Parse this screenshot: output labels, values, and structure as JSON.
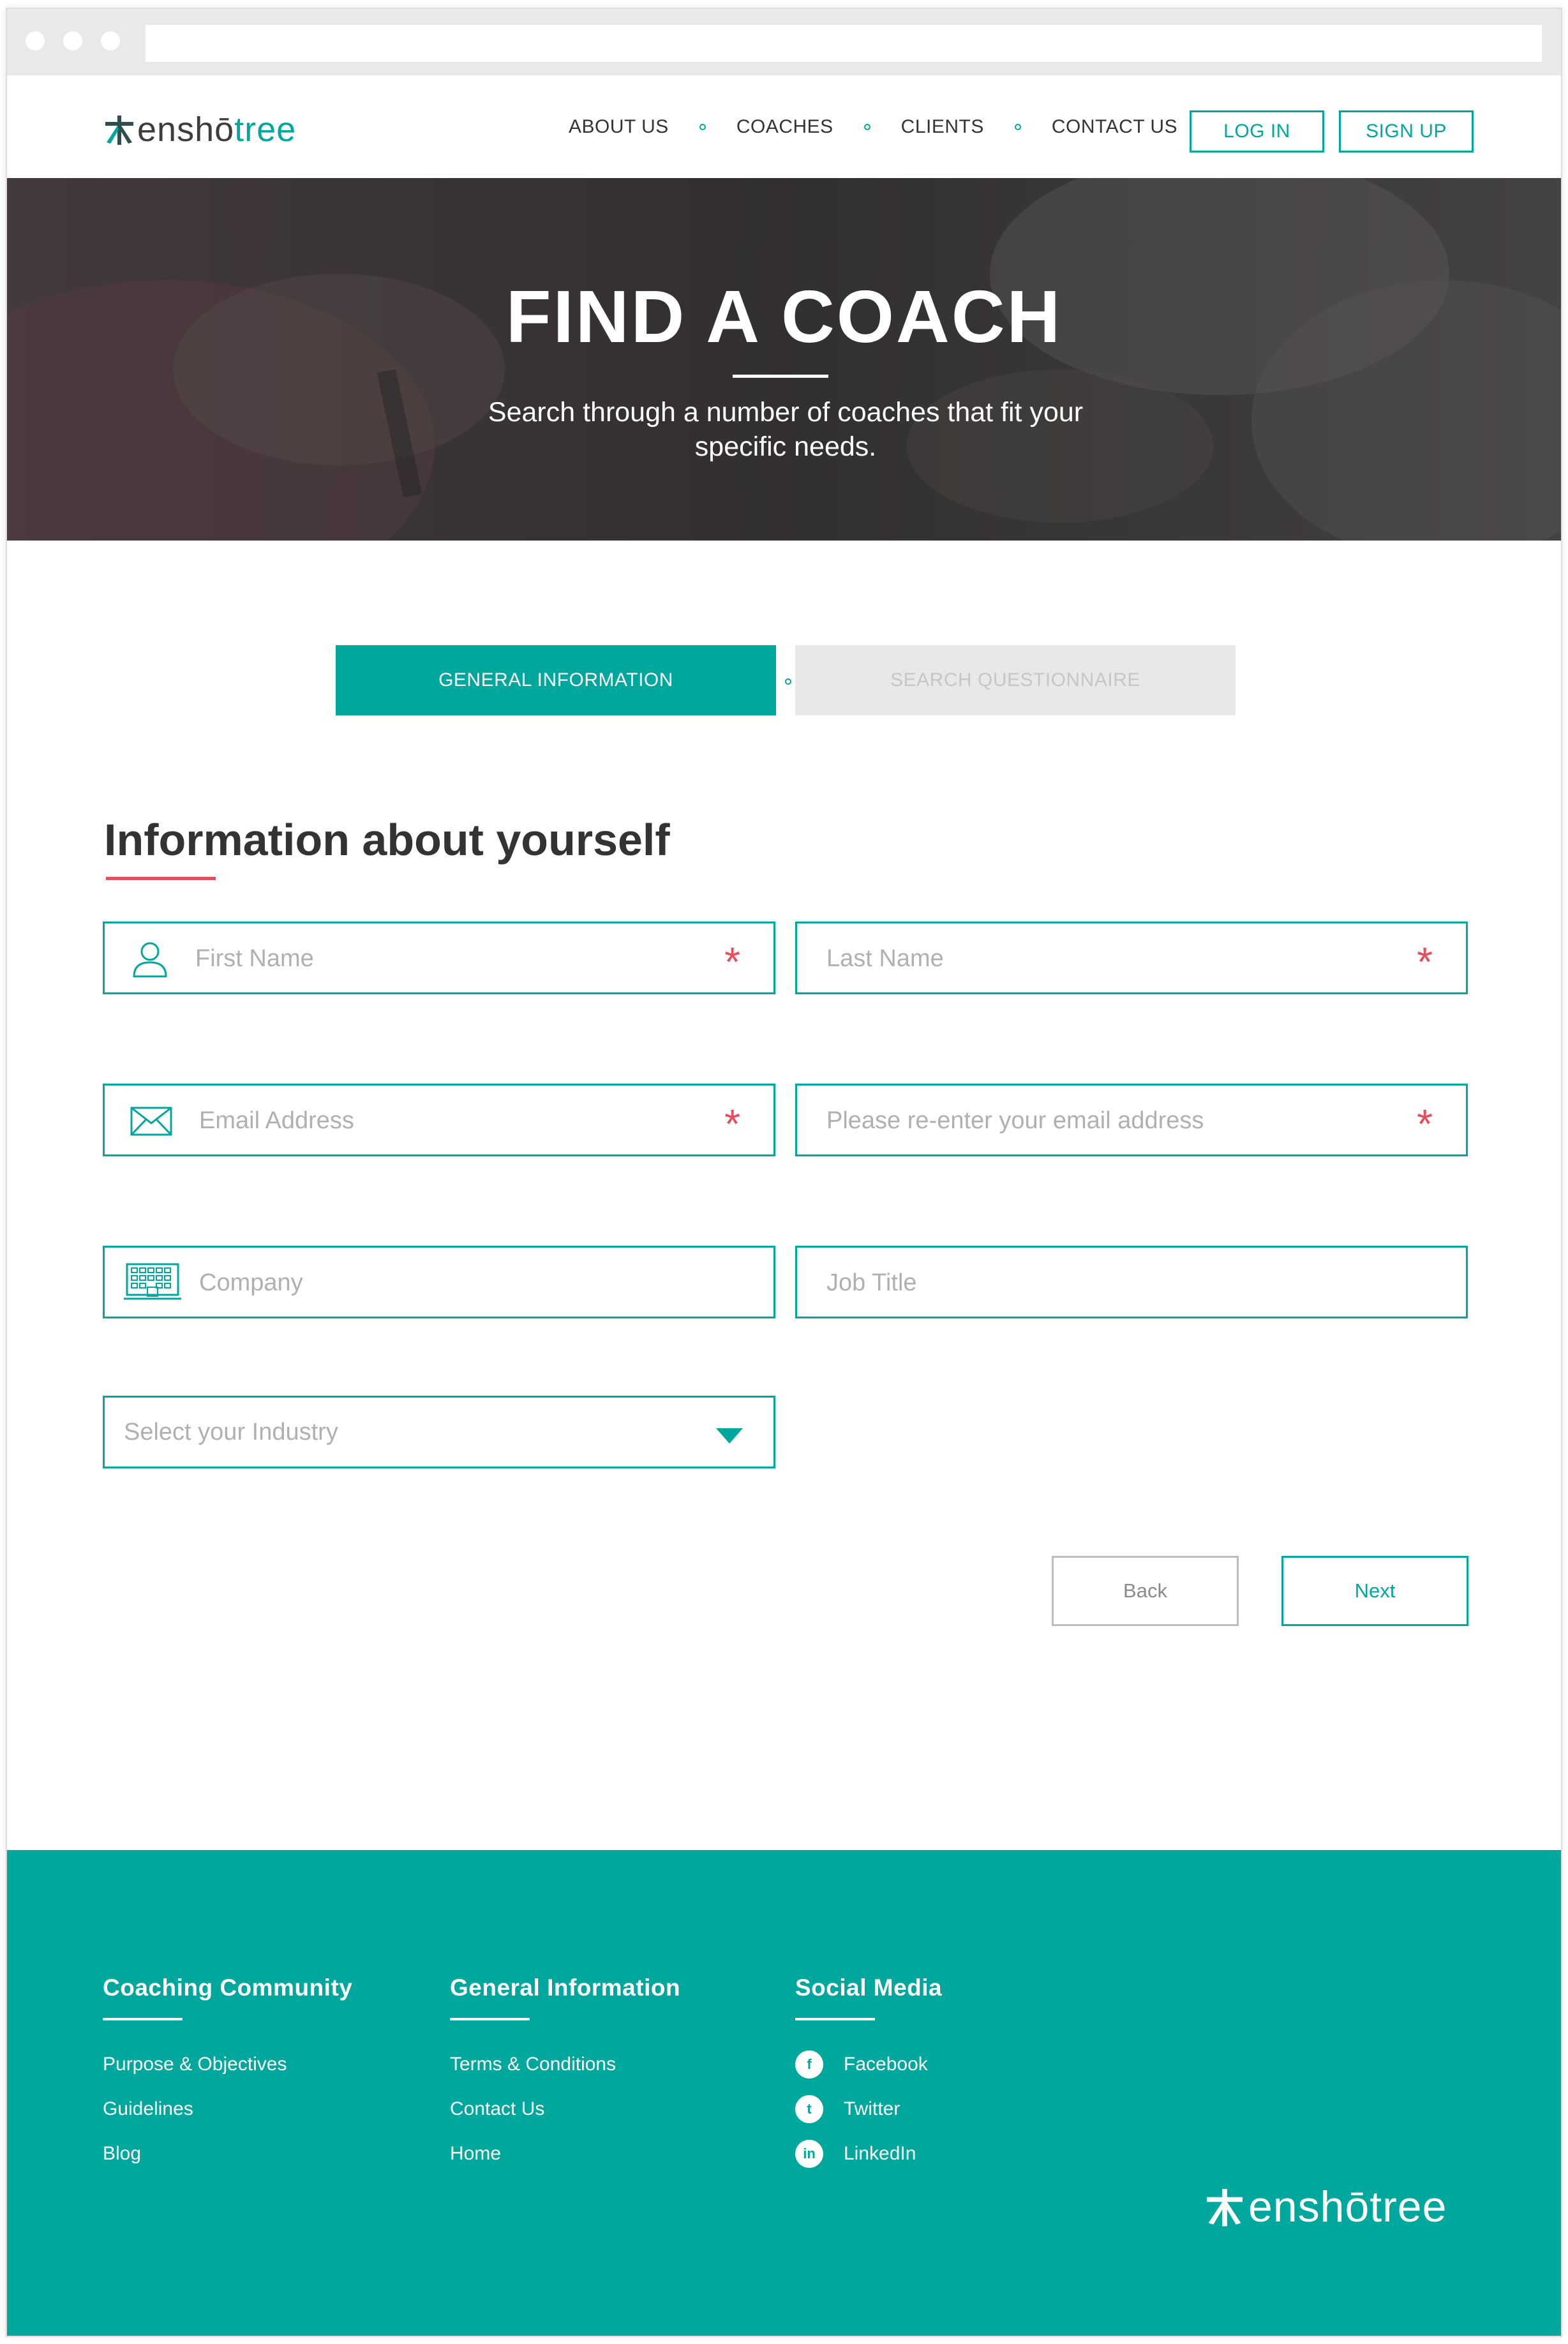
{
  "brand": {
    "name_part1": "enshō",
    "name_part2": "tree",
    "footer_name": "enshōtree",
    "accent_color": "#00a79c",
    "required_color": "#e84d5b"
  },
  "nav": {
    "links": [
      "ABOUT US",
      "COACHES",
      "CLIENTS",
      "CONTACT US"
    ],
    "login": "LOG IN",
    "signup": "SIGN UP"
  },
  "hero": {
    "title": "FIND A COACH",
    "subtitle": "Search through a number of coaches that fit your specific needs."
  },
  "steps": {
    "active": "GENERAL INFORMATION",
    "inactive": "SEARCH QUESTIONNAIRE"
  },
  "form": {
    "title": "Information about yourself",
    "required_mark": "*",
    "fields": {
      "first_name": {
        "placeholder": "First Name",
        "icon": "user-icon"
      },
      "last_name": {
        "placeholder": "Last Name"
      },
      "email": {
        "placeholder": "Email Address",
        "icon": "envelope-icon"
      },
      "email_confirm": {
        "placeholder": "Please re-enter your email address"
      },
      "company": {
        "placeholder": "Company",
        "icon": "building-icon"
      },
      "job_title": {
        "placeholder": "Job Title"
      }
    },
    "industry": {
      "label": "Select your Industry",
      "icon": "chevron-down-icon"
    },
    "back": "Back",
    "next": "Next"
  },
  "footer": {
    "col1": {
      "heading": "Coaching Community",
      "links": [
        "Purpose & Objectives",
        "Guidelines",
        "Blog"
      ]
    },
    "col2": {
      "heading": "General Information",
      "links": [
        "Terms & Conditions",
        "Contact Us",
        "Home"
      ]
    },
    "col3": {
      "heading": "Social Media",
      "links": [
        {
          "label": "Facebook",
          "icon": "facebook-icon",
          "glyph": "f"
        },
        {
          "label": "Twitter",
          "icon": "twitter-icon",
          "glyph": "t"
        },
        {
          "label": "LinkedIn",
          "icon": "linkedin-icon",
          "glyph": "in"
        }
      ]
    }
  }
}
